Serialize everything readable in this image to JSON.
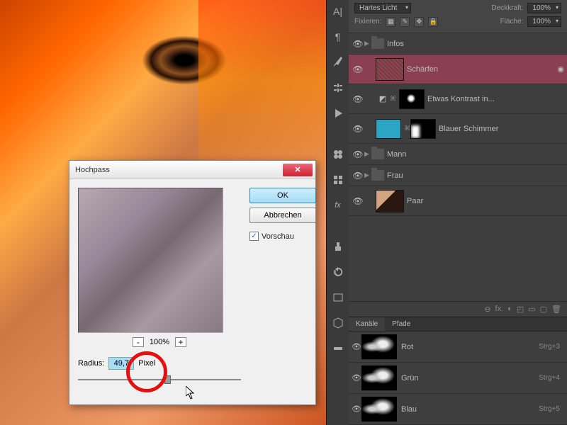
{
  "toolstrip": {
    "tools": [
      "A",
      "brush",
      "adjust",
      "history",
      "play",
      "swatches",
      "paragraph",
      "fx",
      "3d",
      "measure",
      "library"
    ]
  },
  "panel": {
    "blend_mode": "Hartes Licht",
    "opacity_label": "Deckkraft:",
    "opacity_value": "100%",
    "lock_label": "Fixieren:",
    "fill_label": "Fläche:",
    "fill_value": "100%"
  },
  "layers": [
    {
      "name": "Infos",
      "type": "folder"
    },
    {
      "name": "Schärfen",
      "type": "layer",
      "selected": true
    },
    {
      "name": "Etwas Kontrast in...",
      "type": "adj-curves"
    },
    {
      "name": "Blauer Schimmer",
      "type": "adj-solid"
    },
    {
      "name": "Mann",
      "type": "folder"
    },
    {
      "name": "Frau",
      "type": "folder"
    },
    {
      "name": "Paar",
      "type": "layer-pair"
    }
  ],
  "layers_footer": [
    "⊖",
    "fx.",
    "◐",
    "◰",
    "▭",
    "▢",
    "🗑"
  ],
  "channels": {
    "tabs": [
      "Kanäle",
      "Pfade"
    ],
    "list": [
      {
        "name": "Rot",
        "shortcut": "Strg+3"
      },
      {
        "name": "Grün",
        "shortcut": "Strg+4"
      },
      {
        "name": "Blau",
        "shortcut": "Strg+5"
      }
    ]
  },
  "dialog": {
    "title": "Hochpass",
    "ok": "OK",
    "cancel": "Abbrechen",
    "preview": "Vorschau",
    "zoom": "100%",
    "minus": "-",
    "plus": "+",
    "radius_label": "Radius:",
    "radius_value": "49,7",
    "radius_unit": "Pixel"
  }
}
